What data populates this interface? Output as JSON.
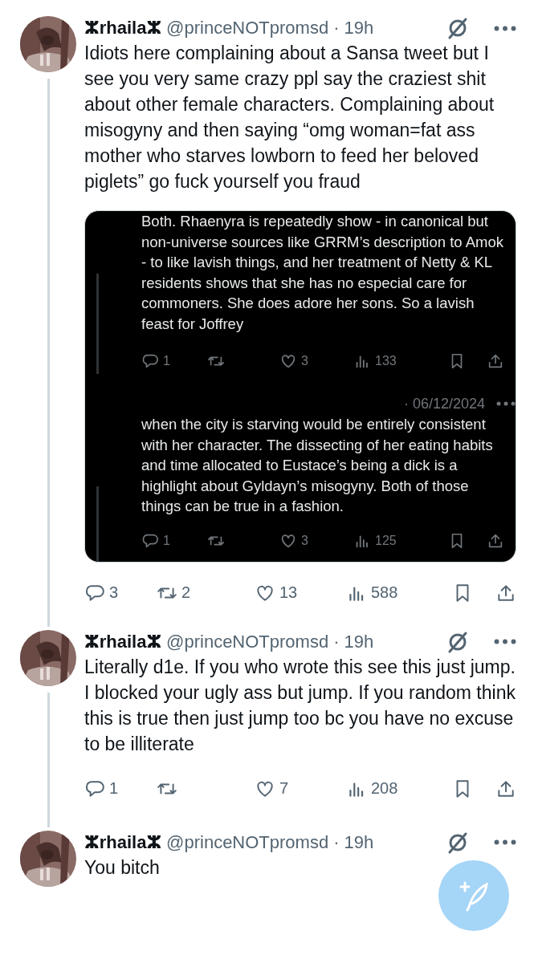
{
  "posts": [
    {
      "author": "ⵣrhailaⵣ",
      "handle": "@princeNOTpromsd",
      "time": "· 19h",
      "thread_line": true,
      "text": "Idiots here complaining about a Sansa tweet but I see you very same crazy ppl say the craziest shit about other female characters. Complaining about misogyny and then saying “omg woman=fat ass mother who starves lowborn to feed her beloved piglets” go fuck yourself you fraud",
      "quote": {
        "kind": "picture-post",
        "segments": [
          {
            "text": "Both. Rhaenyra is repeatedly show - in canonical but non-universe sources like GRRM’s description to Amok - to like lavish things, and her  treatment of Netty & KL residents shows that she has no especial care for commoners. She does adore her sons. So a lavish feast for Joffrey",
            "actions": {
              "replies": "1",
              "likes": "3",
              "views": "133"
            }
          },
          {
            "date": "· 06/12/2024",
            "text": "when the city is starving would be entirely consistent with her character. The dissecting of her eating habits and time allocated to Eustace’s being a dick is a highlight about Gyldayn’s misogyny. Both of those things can be true in a fashion.",
            "actions": {
              "replies": "1",
              "likes": "3",
              "views": "125"
            }
          }
        ]
      },
      "actions": {
        "replies": "3",
        "reposts": "2",
        "likes": "13",
        "views": "588"
      }
    },
    {
      "author": "ⵣrhailaⵣ",
      "handle": "@princeNOTpromsd",
      "time": "· 19h",
      "thread_line": true,
      "text": "Literally d1e. If you who wrote this  see this just jump. I blocked your ugly ass but jump. If you random think this is true then just jump too bc you have no excuse to be illiterate",
      "actions": {
        "replies": "1",
        "likes": "7",
        "views": "208"
      }
    },
    {
      "author": "ⵣrhailaⵣ",
      "handle": "@princeNOTpromsd",
      "time": "· 19h",
      "thread_line": false,
      "text": "You bitch"
    }
  ]
}
